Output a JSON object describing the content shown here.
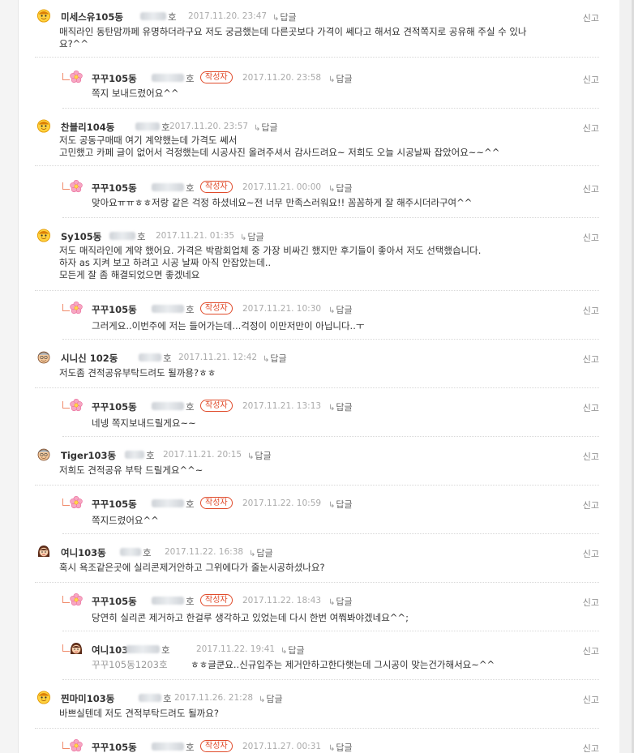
{
  "ui": {
    "report_label": "신고",
    "reply_label": "답글",
    "writer_badge": "작성자"
  },
  "comments": [
    {
      "type": "comment",
      "name": "미세스유105동",
      "ho": "호",
      "date": "2017.11.20. 23:47",
      "text": "매직라인 동탄맘까페 유명하더라구요 저도 궁금했는데 다른곳보다 가격이 쎄다고 해서요 견적쪽지로 공유해 주실 수 있나\n요?^^",
      "icon": "yellow-face-icon"
    },
    {
      "type": "reply",
      "name": "꾸꾸105동",
      "ho": "호",
      "date": "2017.11.20. 23:58",
      "text": "쪽지 보내드렸어요^^",
      "icon": "pink-flower-icon"
    },
    {
      "type": "comment",
      "name": "찬블리104동",
      "ho": "호",
      "date": "2017.11.20. 23:57",
      "text": "저도 공동구매때 여기 계약했는데 가격도 쎄서\n고민했고 카페 글이 없어서 걱정했는데 시공사진 올려주셔서 감사드려요~ 저희도 오늘 시공날짜 잡았어요~~^^",
      "icon": "yellow-face-icon"
    },
    {
      "type": "reply",
      "name": "꾸꾸105동",
      "ho": "호",
      "date": "2017.11.21. 00:00",
      "text": "맞아요ㅠㅠㅎㅎ저랑 같은 걱정 하셨네요~전 너무 만족스러워요!! 꼼꼼하게 잘 해주시더라구여^^",
      "icon": "pink-flower-icon"
    },
    {
      "type": "comment",
      "name": "Sy105동",
      "ho": "호",
      "date": "2017.11.21. 01:35",
      "text": "저도 매직라인에 계약 했어요. 가격은 박람회업체 중 가장 비싸긴 했지만 후기들이 좋아서 저도 선택했습니다.\n하자 as 지켜 보고 하려고 시공 날짜 아직 안잡았는데..\n모든게 잘 좀 해결되었으면 좋겠네요",
      "icon": "yellow-face-icon"
    },
    {
      "type": "reply",
      "name": "꾸꾸105동",
      "ho": "호",
      "date": "2017.11.21. 10:30",
      "text": "그러게요..이번주에 저는 들어가는데...걱정이 이만저만이 아닙니다..ㅜ",
      "icon": "pink-flower-icon"
    },
    {
      "type": "comment",
      "name": "시니신 102동",
      "ho": "호",
      "date": "2017.11.21. 12:42",
      "text": "저도좀 견적공유부탁드려도 될까용?ㅎㅎ",
      "icon": "grandpa-face-icon"
    },
    {
      "type": "reply",
      "name": "꾸꾸105동",
      "ho": "호",
      "date": "2017.11.21. 13:13",
      "text": "네넹 쪽지보내드릴게요~~",
      "icon": "pink-flower-icon"
    },
    {
      "type": "comment",
      "name": "Tiger103동",
      "ho": "호",
      "date": "2017.11.21. 20:15",
      "text": "저희도 견적공유 부탁 드릴게요^^~",
      "icon": "grandpa-face-icon"
    },
    {
      "type": "reply",
      "name": "꾸꾸105동",
      "ho": "호",
      "date": "2017.11.22. 10:59",
      "text": "쪽지드렸어요^^",
      "icon": "pink-flower-icon"
    },
    {
      "type": "comment",
      "name": "여니103동",
      "ho": "호",
      "date": "2017.11.22. 16:38",
      "text": "혹시 욕조같은곳에 실리콘제거안하고 그위에다가 줄눈시공하셨나요?",
      "icon": "girl-face-icon"
    },
    {
      "type": "reply",
      "name": "꾸꾸105동",
      "ho": "호",
      "date": "2017.11.22. 18:43",
      "text": "당연히 실리콘 제거하고 한걸루 생각하고 있었는데 다시 한번 여쭤봐야겠네요^^;",
      "icon": "pink-flower-icon"
    },
    {
      "type": "reply2",
      "name": "여니103",
      "ho": "호",
      "date": "2017.11.22. 19:41",
      "mention": "꾸꾸105동1203호",
      "text": "ㅎㅎ글쿤요..신규입주는 제거안하고한다햇는데 그시공이 맞는건가해서요~^^",
      "icon": "girl-face-icon"
    },
    {
      "type": "comment",
      "name": "찐마미103동",
      "ho": "호",
      "date": "2017.11.26. 21:28",
      "text": "바쁘실텐데 저도 견적부탁드려도 될까요?",
      "icon": "yellow-face-icon"
    },
    {
      "type": "reply",
      "name": "꾸꾸105동",
      "ho": "호",
      "date": "2017.11.27. 00:31",
      "text": "",
      "icon": "pink-flower-icon"
    }
  ]
}
